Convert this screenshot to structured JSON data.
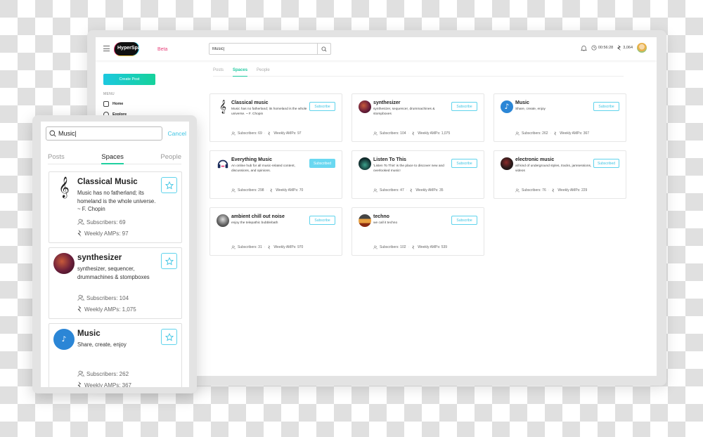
{
  "app": {
    "logo_text": "HyperSpace",
    "logo_badge": "Beta",
    "search_value": "Music|",
    "timer": "00:56:28",
    "amps_balance": "3,064"
  },
  "sidebar": {
    "create_post": "Create Post",
    "menu_label": "MENU",
    "items": [
      {
        "label": "Home",
        "icon": "home-icon"
      },
      {
        "label": "Explore",
        "icon": "compass-icon"
      }
    ]
  },
  "tabs": [
    {
      "label": "Posts",
      "active": false
    },
    {
      "label": "Spaces",
      "active": true
    },
    {
      "label": "People",
      "active": false
    }
  ],
  "colors": {
    "accent_teal": "#1fc9a0",
    "accent_cyan": "#3cc4e3",
    "brand_pink": "#e8407a"
  },
  "spaces": [
    {
      "title": "Classical music",
      "desc": "Music has no fatherland; its homeland is the whole universe. ~ F. Chopin",
      "subscribers": "Subscribers: 69",
      "amps": "Weekly AMPs: 97",
      "button": "Subscribe",
      "icon": "treble-clef-icon"
    },
    {
      "title": "synthesizer",
      "desc": "synthesizer, sequencer, drummachines & stompboxes",
      "subscribers": "Subscribers: 104",
      "amps": "Weekly AMPs: 1,075",
      "button": "Subscribe",
      "icon": "synth-photo"
    },
    {
      "title": "Music",
      "desc": "Share, create, enjoy",
      "subscribers": "Subscribers: 262",
      "amps": "Weekly AMPs: 367",
      "button": "Subscribe",
      "icon": "music-note-icon"
    },
    {
      "title": "Everything Music",
      "desc": "An online hub for all music-related content, discussions, and opinions.",
      "subscribers": "Subscribers: 298",
      "amps": "Weekly AMPs: 70",
      "button": "Subscribed",
      "icon": "headphones-icon"
    },
    {
      "title": "Listen To This",
      "desc": "'Listen To This' is the place to discover new and overlooked music!",
      "subscribers": "Subscribers: 47",
      "amps": "Weekly AMPs: 35",
      "button": "Subscribe",
      "icon": "listen-photo"
    },
    {
      "title": "electronic music",
      "desc": "all kind of underground styles, tracks, jamsessions, videos",
      "subscribers": "Subscribers: 76",
      "amps": "Weekly AMPs: 229",
      "button": "Subscribed",
      "icon": "electronic-photo"
    },
    {
      "title": "ambient chill out noise",
      "desc": "enjoy the telepathic bubblebath",
      "subscribers": "Subscribers: 31",
      "amps": "Weekly AMPs: 970",
      "button": "Subscribe",
      "icon": "ambient-photo"
    },
    {
      "title": "techno",
      "desc": "we call it techno",
      "subscribers": "Subscribers: 102",
      "amps": "Weekly AMPs: 539",
      "button": "Subscribe",
      "icon": "techno-photo"
    }
  ],
  "mobile": {
    "search_value": "Music|",
    "cancel": "Cancel",
    "tabs": [
      "Posts",
      "Spaces",
      "People"
    ],
    "cards": [
      {
        "title": "Classical Music",
        "desc": "Music has no fatherland; its homeland is the whole universe. ~ F. Chopin",
        "subscribers": "Subscribers: 69",
        "amps": "Weekly AMPs: 97"
      },
      {
        "title": "synthesizer",
        "desc": "synthesizer, sequencer, drummachines & stompboxes",
        "subscribers": "Subscribers: 104",
        "amps": "Weekly AMPs: 1,075"
      },
      {
        "title": "Music",
        "desc": "Share, create, enjoy",
        "subscribers": "Subscribers: 262",
        "amps": "Weekly AMPs: 367"
      }
    ]
  }
}
